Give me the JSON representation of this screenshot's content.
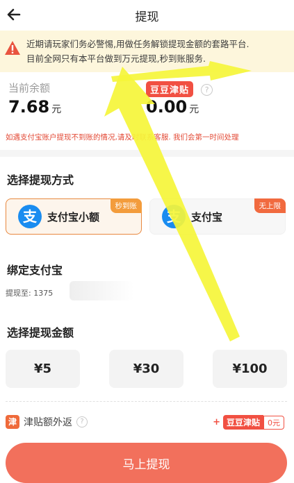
{
  "header": {
    "title": "提现"
  },
  "notice": {
    "line1": "近期请玩家们务必警惕,用做任务解锁提现金额的套路平台.",
    "line2": "目前全网只有本平台做到万元提现,秒到账服务."
  },
  "balance": {
    "label": "当前余额",
    "amount": "7.68",
    "unit": "元"
  },
  "subsidy": {
    "badge": "豆豆津贴",
    "help": "?",
    "amount": "0.00",
    "unit": "元"
  },
  "tip": "如遇支付宝账户提现不到账的情况,请及时联系客服. 我们会第一时间处理",
  "method_section": {
    "title": "选择提现方式",
    "options": [
      {
        "label": "支付宝小额",
        "corner": "秒到账",
        "icon": "alipay-icon",
        "selected": true
      },
      {
        "label": "支付宝",
        "corner": "无上限",
        "icon": "alipay-icon",
        "selected": false
      }
    ]
  },
  "bind_section": {
    "title": "绑定支付宝",
    "label": "提现至: 1375"
  },
  "amount_section": {
    "title": "选择提现金额",
    "options": [
      "¥5",
      "¥30",
      "¥100"
    ]
  },
  "rebate": {
    "icon_text": "津",
    "label": "津贴额外返",
    "help": "?",
    "plus": "+",
    "badge": "豆豆津贴",
    "value": "0元"
  },
  "submit": {
    "label": "马上提现"
  },
  "colors": {
    "accent": "#f2705c",
    "subsidy_red": "#f15042",
    "alipay_blue": "#1a8cf0",
    "notice_bg": "#fdf6dc",
    "annotation_yellow": "#f5f53a"
  }
}
